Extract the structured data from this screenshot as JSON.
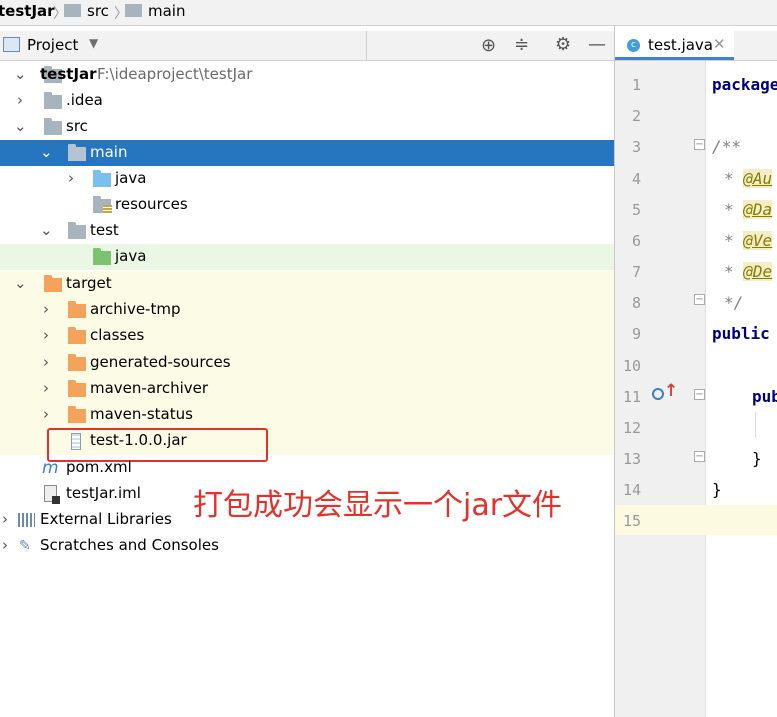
{
  "breadcrumb": [
    "testJar",
    "src",
    "main"
  ],
  "project_panel": {
    "title": "Project"
  },
  "tree": {
    "root": {
      "label": "testJar",
      "path": "F:\\ideaproject\\testJar"
    },
    "idea": ".idea",
    "src": "src",
    "main": "main",
    "main_java": "java",
    "resources": "resources",
    "test": "test",
    "test_java": "java",
    "target": "target",
    "archive_tmp": "archive-tmp",
    "classes": "classes",
    "generated_sources": "generated-sources",
    "maven_archiver": "maven-archiver",
    "maven_status": "maven-status",
    "jar": "test-1.0.0.jar",
    "pom": "pom.xml",
    "iml": "testJar.iml",
    "external_libraries": "External Libraries",
    "scratches": "Scratches and Consoles"
  },
  "annotation_text": "打包成功会显示一个jar文件",
  "editor": {
    "tab_label": "test.java",
    "line_numbers": [
      "1",
      "2",
      "3",
      "4",
      "5",
      "6",
      "7",
      "8",
      "9",
      "10",
      "11",
      "12",
      "13",
      "14",
      "15"
    ],
    "line1": "package",
    "line3": "/**",
    "ann_star": "*",
    "ann4": "@Au",
    "ann5": "@Da",
    "ann6": "@Ve",
    "ann7": "@De",
    "line8": "*/",
    "line9": "public",
    "line11": "pub",
    "line13": "}",
    "line14": "}"
  },
  "colors": {
    "selection": "#2675bf",
    "target_bg": "#fbfbe6",
    "test_java_bg": "#eaf7e5",
    "annotation_red": "#e8302a",
    "blue_folder": "#79bff0",
    "orange_folder": "#f5a25d",
    "gray_folder": "#a7b3bd",
    "green_folder": "#7bc36e"
  }
}
